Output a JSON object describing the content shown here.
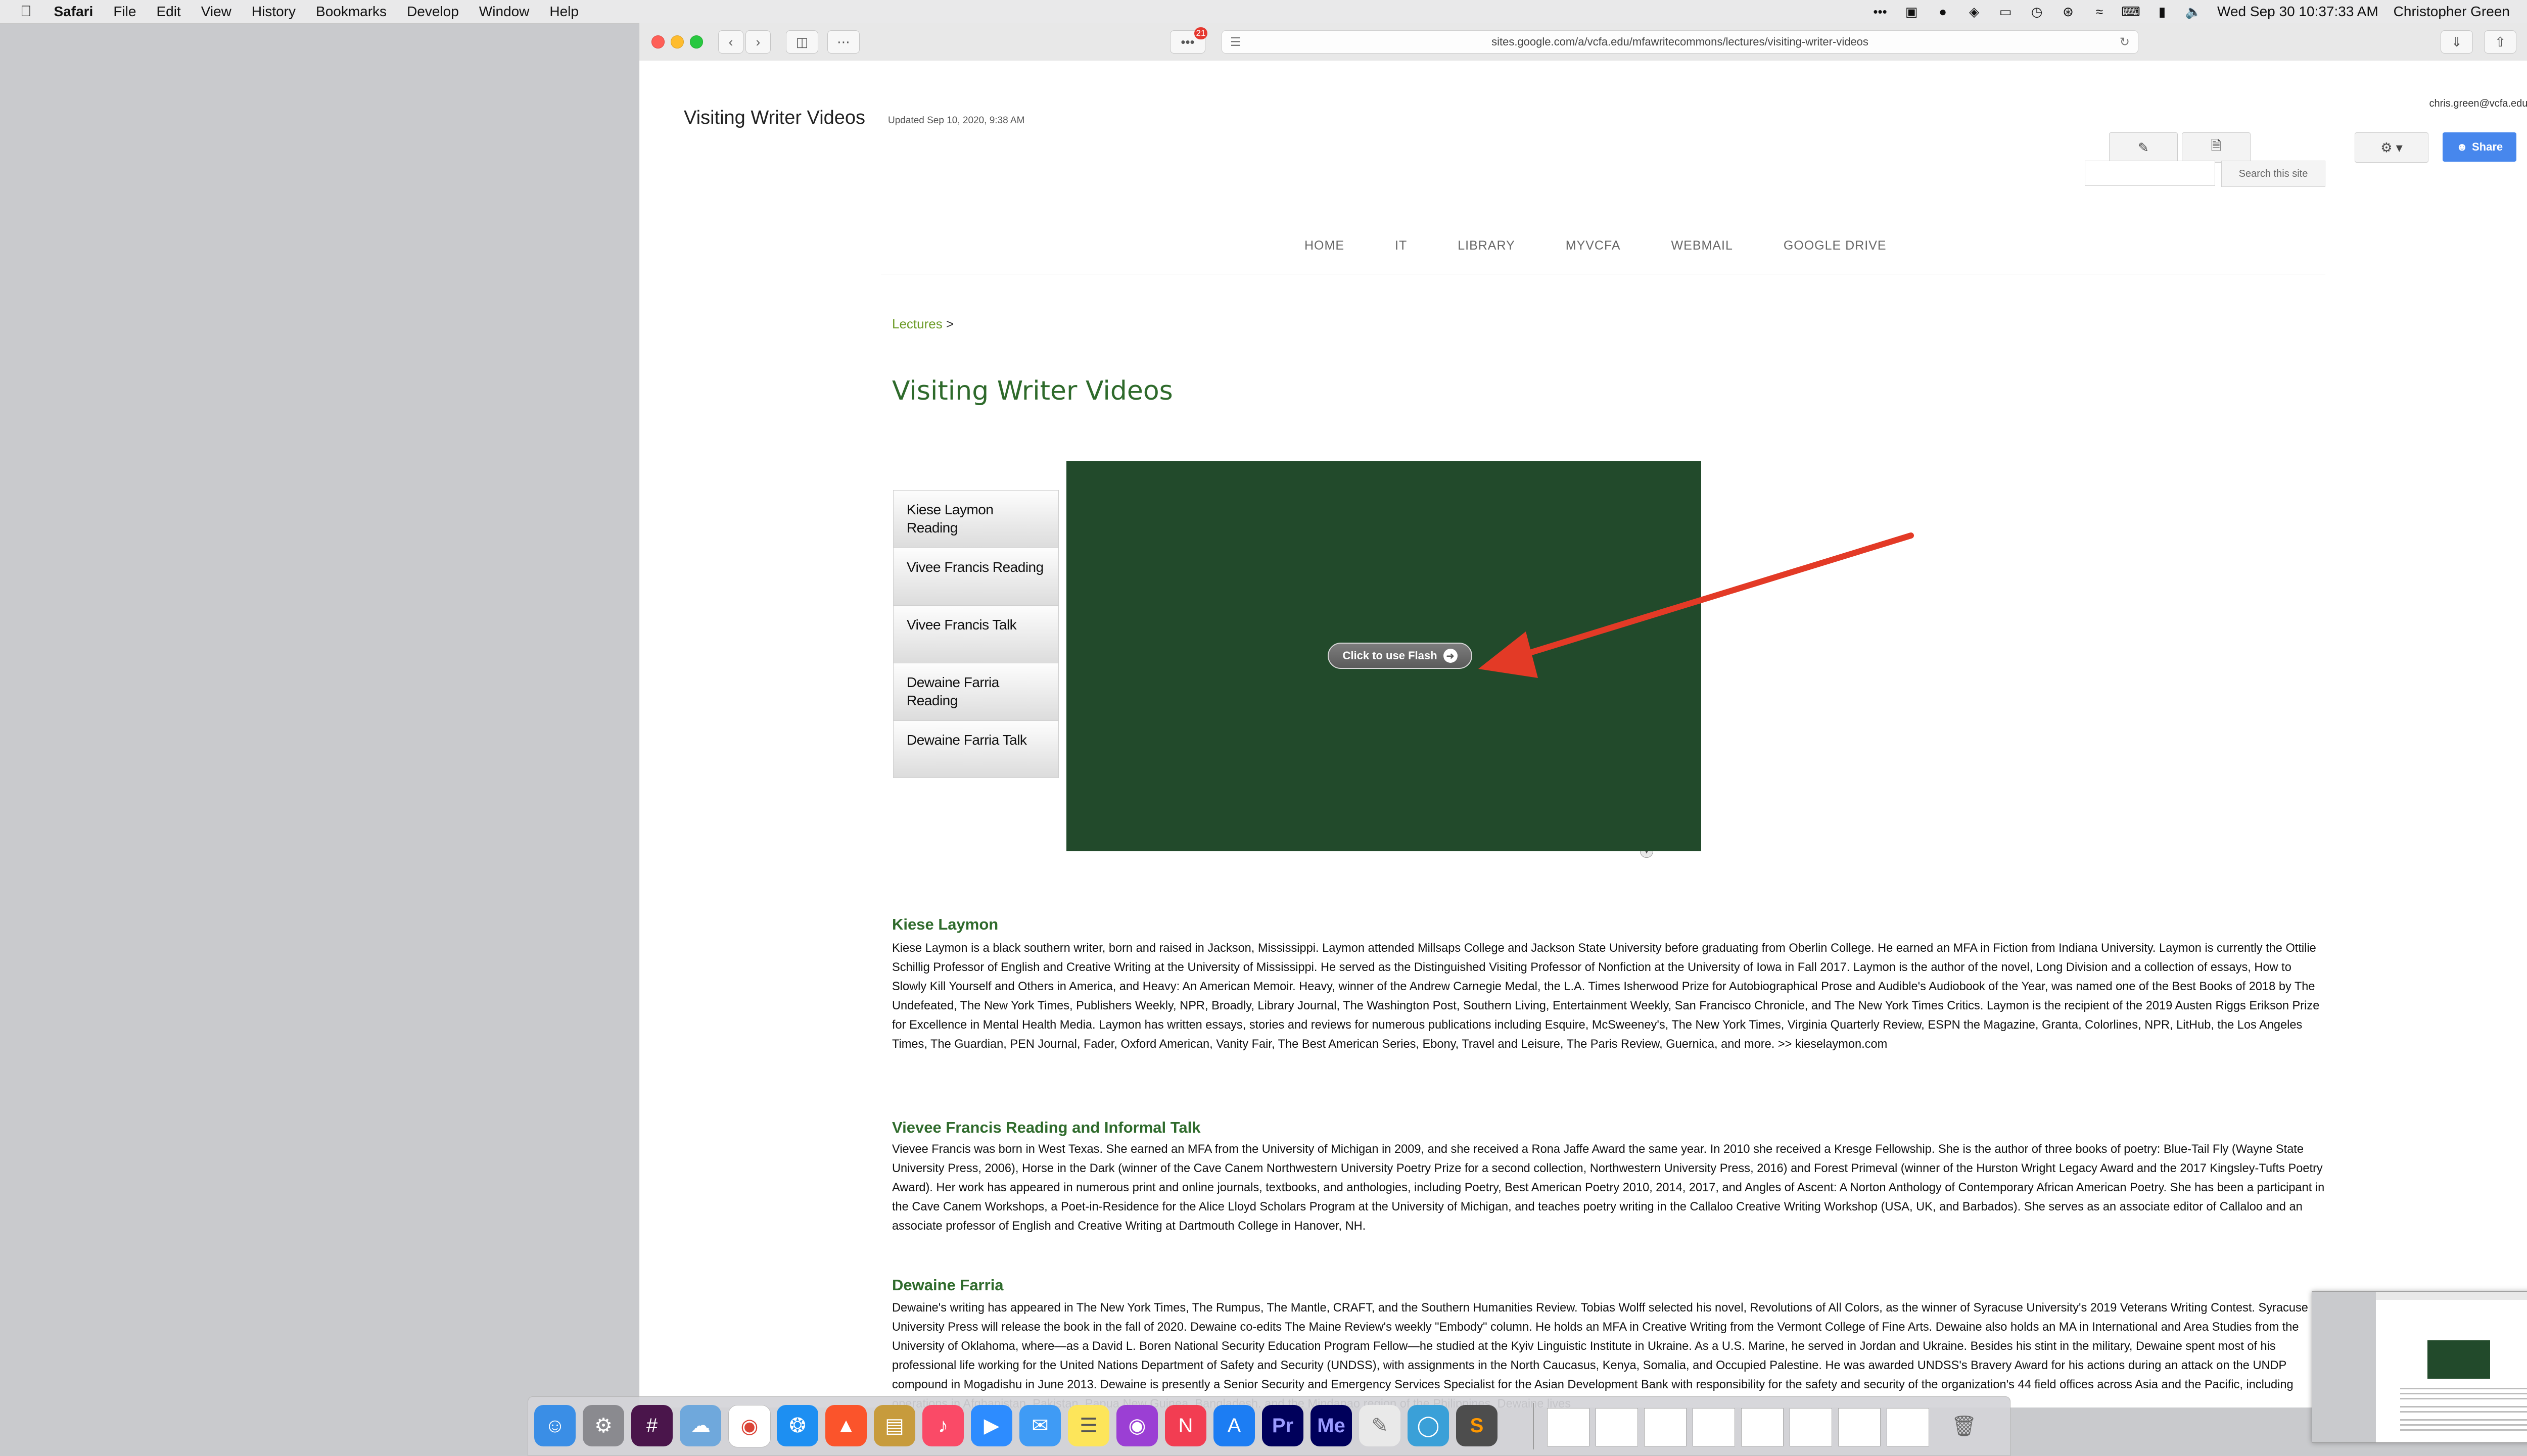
{
  "menubar": {
    "app": "Safari",
    "items": [
      "File",
      "Edit",
      "View",
      "History",
      "Bookmarks",
      "Develop",
      "Window",
      "Help"
    ],
    "clock": "Wed Sep 30  10:37:33 AM",
    "user": "Christopher Green"
  },
  "browser": {
    "url": "sites.google.com/a/vcfa.edu/mfawritecommons/lectures/visiting-writer-videos",
    "extension_badge": "21"
  },
  "site": {
    "title": "Visiting Writer Videos",
    "updated": "Updated Sep 10, 2020, 9:38 AM",
    "account": "chris.green@vcfa.edu",
    "share_label": "Share",
    "search_button": "Search this site",
    "nav": [
      "HOME",
      "IT",
      "LIBRARY",
      "MYVCFA",
      "WEBMAIL",
      "GOOGLE DRIVE"
    ],
    "breadcrumb": "Lectures",
    "breadcrumb_sep": ">",
    "page_title": "Visiting Writer Videos"
  },
  "video": {
    "list": [
      "Kiese Laymon Reading",
      "Vivee Francis Reading",
      "Vivee Francis Talk",
      "Dewaine Farria Reading",
      "Dewaine Farria Talk"
    ],
    "flash_label": "Click to use Flash",
    "player_color": "#224a2b",
    "arrow_color": "#e33a26"
  },
  "bios": [
    {
      "heading": "Kiese Laymon",
      "text": "Kiese Laymon is a black southern writer, born and raised in Jackson, Mississippi. Laymon attended Millsaps College and Jackson State University before graduating from Oberlin College. He earned an MFA in Fiction from Indiana University. Laymon is currently the Ottilie Schillig Professor of English and Creative Writing at the University of Mississippi. He served as the Distinguished Visiting Professor of Nonfiction at the University of Iowa in Fall 2017. Laymon is the author of the novel, Long Division and a collection of essays, How to Slowly Kill Yourself and Others in America, and Heavy: An American Memoir. Heavy, winner of the Andrew Carnegie Medal, the L.A. Times Isherwood Prize for Autobiographical Prose and Audible's Audiobook of the Year, was named one of the Best Books of 2018 by The Undefeated, The New York Times, Publishers Weekly, NPR, Broadly, Library Journal, The Washington Post, Southern Living, Entertainment Weekly, San Francisco Chronicle, and The New York Times Critics. Laymon is the recipient of the 2019 Austen Riggs Erikson Prize for Excellence in Mental Health Media. Laymon has written essays, stories and reviews for numerous publications including Esquire, McSweeney's, The New York Times, Virginia Quarterly Review, ESPN the Magazine, Granta, Colorlines, NPR, LitHub, the Los Angeles Times, The Guardian, PEN Journal, Fader, Oxford American, Vanity Fair, The Best American Series, Ebony, Travel and Leisure, The Paris Review, Guernica, and more. >> kieselaymon.com"
    },
    {
      "heading": "Vievee Francis Reading and Informal Talk",
      "text": "Vievee Francis was born in West Texas. She earned an MFA from the University of Michigan in 2009, and she received a Rona Jaffe Award the same year. In 2010 she received a Kresge Fellowship. She is the author of three books of poetry: Blue-Tail Fly (Wayne State University Press, 2006), Horse in the Dark (winner of the Cave Canem Northwestern University Poetry Prize for a second collection, Northwestern University Press, 2016) and Forest Primeval (winner of the Hurston Wright Legacy Award and the 2017 Kingsley-Tufts Poetry Award). Her work has appeared in numerous print and online journals, textbooks, and anthologies, including Poetry, Best American Poetry 2010, 2014, 2017, and Angles of Ascent: A Norton Anthology of Contemporary African American Poetry. She has been a participant in the Cave Canem Workshops, a Poet-in-Residence for the Alice Lloyd Scholars Program at the University of Michigan, and teaches poetry writing in the Callaloo Creative Writing Workshop (USA, UK, and Barbados). She serves as an associate editor of Callaloo and an associate professor of English and Creative Writing at Dartmouth College in Hanover, NH."
    },
    {
      "heading": "Dewaine Farria",
      "text": "Dewaine's writing has appeared in The New York Times, The Rumpus, The Mantle, CRAFT, and the Southern Humanities Review. Tobias Wolff selected his novel, Revolutions of All Colors, as the winner of Syracuse University's 2019 Veterans Writing Contest. Syracuse University Press will release the book in the fall of 2020. Dewaine co-edits The Maine Review's weekly \"Embody\" column. He holds an MFA in Creative Writing from the Vermont College of Fine Arts. Dewaine also holds an MA in International and Area Studies from the University of Oklahoma, where—as a David L. Boren National Security Education Program Fellow—he studied at the Kyiv Linguistic Institute in Ukraine. As a U.S. Marine, he served in Jordan and Ukraine. Besides his stint in the military, Dewaine spent most of his professional life working for the United Nations Department of Safety and Security (UNDSS), with assignments in the North Caucasus, Kenya, Somalia, and Occupied Palestine. He was awarded UNDSS's Bravery Award for his actions during an attack on the UNDP compound in Mogadishu in June 2013. Dewaine is presently a Senior Security and Emergency Services Specialist for the Asian Development Bank with responsibility for the safety and security of the organization's 44 field offices across Asia and the Pacific, including operations in Afghanistan, Pakistan, Papua New Guinea, Bangladesh, and the Mindanao region of the Philippines. Dewaine lives"
    }
  ],
  "dock": {
    "apps": [
      "finder-icon",
      "system-preferences-icon",
      "slack-icon",
      "preview-icon",
      "chrome-icon",
      "safari-icon",
      "brave-icon",
      "archive-icon",
      "music-icon",
      "zoom-icon",
      "messages-icon",
      "notes-icon",
      "podcasts-icon",
      "news-icon",
      "app-store-icon",
      "premiere-icon",
      "media-encoder-icon",
      "script-icon",
      "browser-icon",
      "sublime-icon"
    ],
    "labels": {
      "premiere": "Pr",
      "media_encoder": "Me",
      "sublime": "S"
    }
  }
}
